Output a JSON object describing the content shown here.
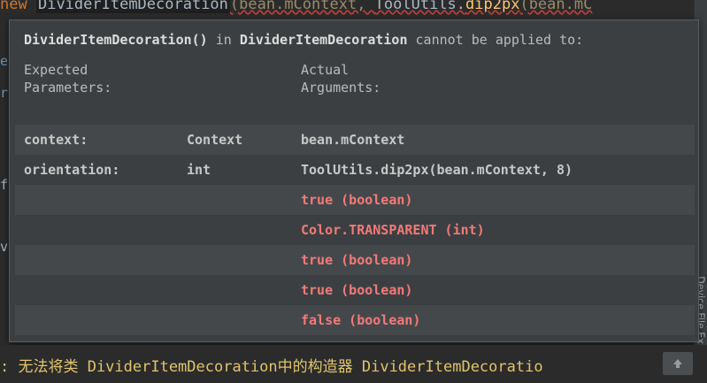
{
  "editor": {
    "code_line": {
      "kw": "new",
      "cls": "DividerItemDecoration",
      "rest_grey": "(bean.mContext, ",
      "tool": "ToolUtils.",
      "fn": "dip2px",
      "tail": "(bean.mC"
    },
    "gutter": [
      "e",
      "r",
      "f",
      "v"
    ]
  },
  "tooltip": {
    "title_name": "DividerItemDecoration()",
    "title_in": "in",
    "title_class": "DividerItemDecoration",
    "title_suffix": "cannot be applied to:",
    "expected_header": "Expected\nParameters:",
    "actual_header": "Actual\nArguments:",
    "rows": [
      {
        "name": "context:",
        "type": "Context",
        "arg": "bean.mContext",
        "error": false
      },
      {
        "name": "orientation:",
        "type": "int",
        "arg": "ToolUtils.dip2px(bean.mContext, 8)",
        "error": false
      },
      {
        "name": "",
        "type": "",
        "arg": "true  (boolean)",
        "error": true
      },
      {
        "name": "",
        "type": "",
        "arg": "Color.TRANSPARENT  (int)",
        "error": true
      },
      {
        "name": "",
        "type": "",
        "arg": "true  (boolean)",
        "error": true
      },
      {
        "name": "",
        "type": "",
        "arg": "true  (boolean)",
        "error": true
      },
      {
        "name": "",
        "type": "",
        "arg": "false  (boolean)",
        "error": true
      }
    ]
  },
  "bottom": {
    "message": ": 无法将类 DividerItemDecoration中的构造器 DividerItemDecoratio"
  },
  "side_tab": {
    "label": "Device File Ex"
  },
  "colors": {
    "error_text": "#f17a7a",
    "warning_text": "#e0c46c",
    "popup_bg": "#3c3f41",
    "row_shade": "#45484a"
  },
  "icons": {
    "scroll_up": "arrow-up-icon"
  }
}
